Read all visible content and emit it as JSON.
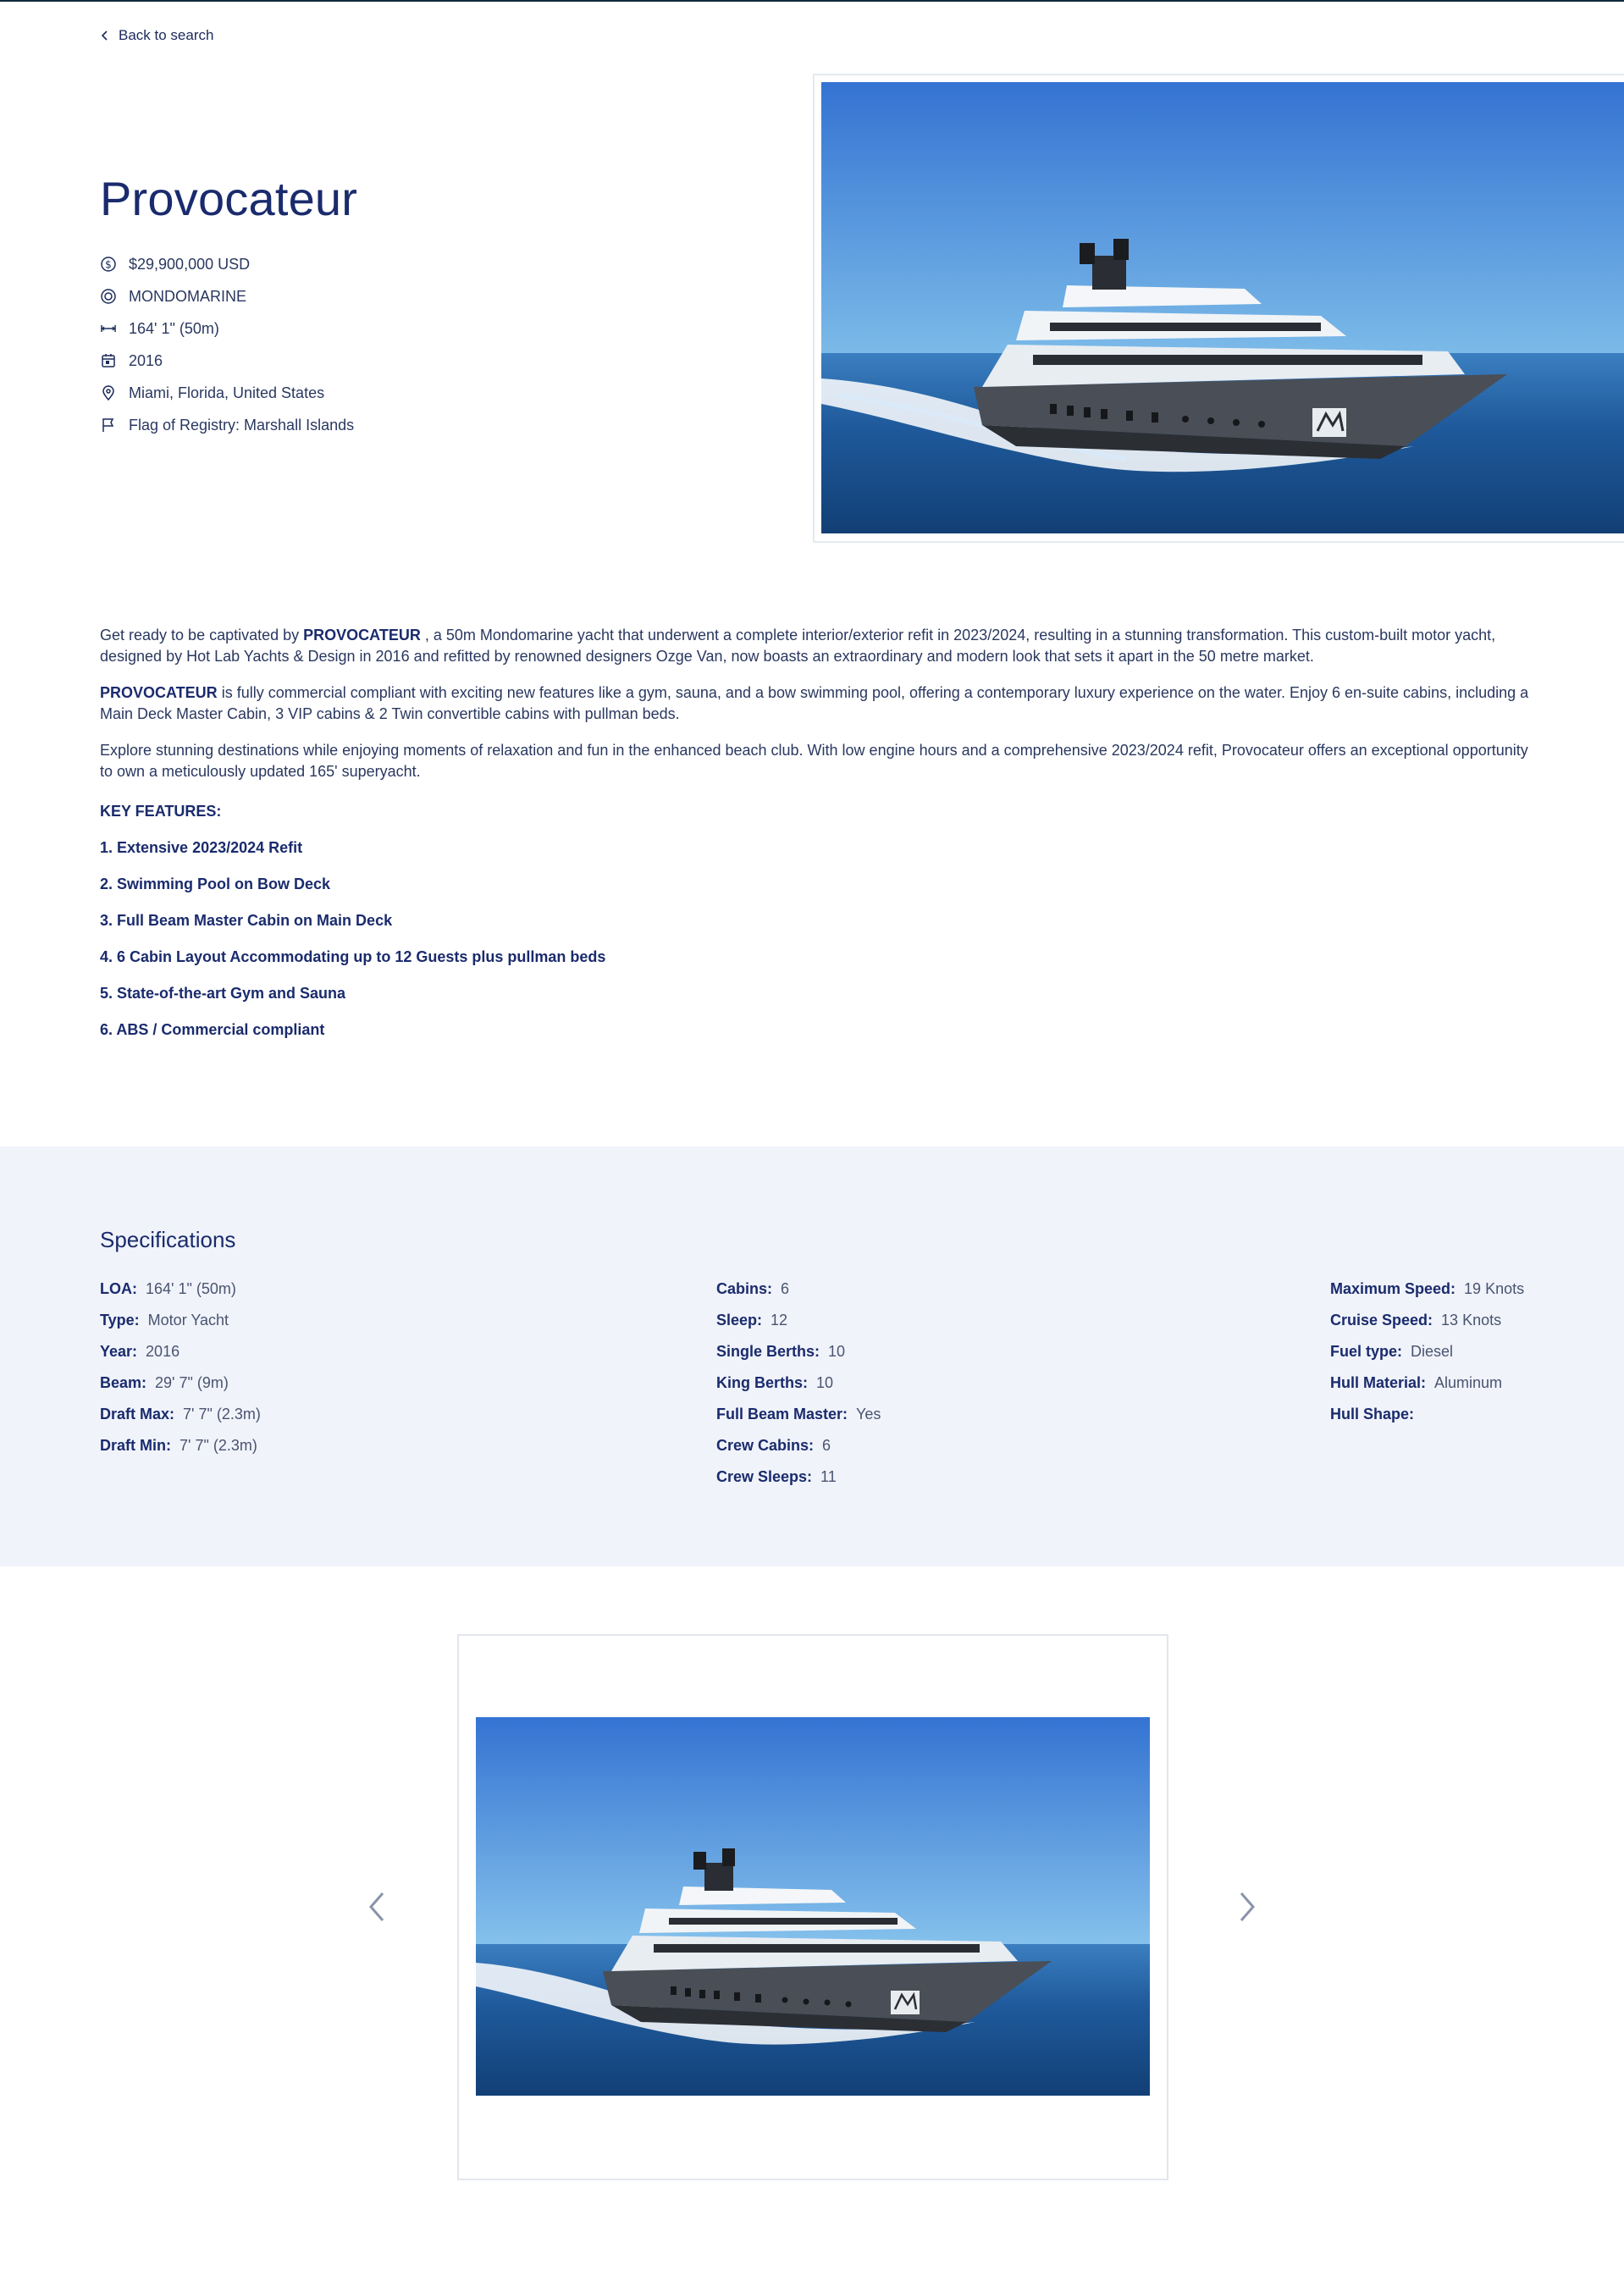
{
  "nav": {
    "back_label": "Back to search"
  },
  "listing": {
    "title": "Provocateur",
    "facts": [
      {
        "icon": "dollar-icon",
        "text": "$29,900,000 USD"
      },
      {
        "icon": "builder-icon",
        "text": "MONDOMARINE"
      },
      {
        "icon": "length-icon",
        "text": "164' 1\" (50m)"
      },
      {
        "icon": "calendar-icon",
        "text": "2016"
      },
      {
        "icon": "location-pin-icon",
        "text": "Miami, Florida, United States"
      },
      {
        "icon": "flag-icon",
        "text": "Flag of Registry: Marshall Islands"
      }
    ]
  },
  "description": {
    "p1": {
      "before": "Get ready to be captivated by ",
      "bold": "PROVOCATEUR",
      "after": " , a 50m Mondomarine yacht that underwent a complete interior/exterior refit in 2023/2024, resulting in a stunning transformation. This custom-built motor yacht, designed by Hot Lab Yachts & Design in 2016 and refitted by renowned designers Ozge Van, now boasts an extraordinary and modern look that sets it apart in the 50 metre market."
    },
    "p2": {
      "bold": "PROVOCATEUR",
      "after": " is fully commercial compliant with exciting new features like a gym, sauna, and a bow swimming pool, offering a contemporary luxury experience on the water. Enjoy 6 en-suite cabins, including a Main Deck Master Cabin, 3 VIP cabins & 2 Twin convertible cabins with pullman beds."
    },
    "p3": "Explore stunning destinations while enjoying moments of relaxation and fun in the enhanced beach club. With low engine hours and a comprehensive 2023/2024 refit, Provocateur offers an exceptional opportunity to own a meticulously updated 165' superyacht.",
    "key_features_heading": "KEY FEATURES:",
    "key_features": [
      "1. Extensive 2023/2024 Refit",
      "2. Swimming Pool on Bow Deck",
      "3. Full Beam Master Cabin on Main Deck",
      "4. 6 Cabin Layout Accommodating up to 12 Guests plus pullman beds",
      "5. State-of-the-art Gym and Sauna",
      "6. ABS / Commercial compliant"
    ]
  },
  "specs": {
    "heading": "Specifications",
    "col1": [
      {
        "k": "LOA:",
        "v": "164' 1\" (50m)"
      },
      {
        "k": "Type:",
        "v": "Motor Yacht"
      },
      {
        "k": "Year:",
        "v": "2016"
      },
      {
        "k": "Beam:",
        "v": "29' 7\" (9m)"
      },
      {
        "k": "Draft Max:",
        "v": "7' 7\" (2.3m)"
      },
      {
        "k": "Draft Min:",
        "v": "7' 7\" (2.3m)"
      }
    ],
    "col2": [
      {
        "k": "Cabins:",
        "v": "6"
      },
      {
        "k": "Sleep:",
        "v": "12"
      },
      {
        "k": "Single Berths:",
        "v": "10"
      },
      {
        "k": "King Berths:",
        "v": "10"
      },
      {
        "k": "Full Beam Master:",
        "v": "Yes"
      },
      {
        "k": "Crew Cabins:",
        "v": "6"
      },
      {
        "k": "Crew Sleeps:",
        "v": "11"
      }
    ],
    "col3": [
      {
        "k": "Maximum Speed:",
        "v": "19 Knots"
      },
      {
        "k": "Cruise Speed:",
        "v": "13 Knots"
      },
      {
        "k": "Fuel type:",
        "v": "Diesel"
      },
      {
        "k": "Hull Material:",
        "v": "Aluminum"
      },
      {
        "k": "Hull Shape:",
        "v": ""
      }
    ]
  },
  "colors": {
    "primary": "#1a2b6d",
    "specs_bg": "#f0f3fa",
    "sea": "#1d4f8c",
    "sky": "#3a7bd5"
  }
}
